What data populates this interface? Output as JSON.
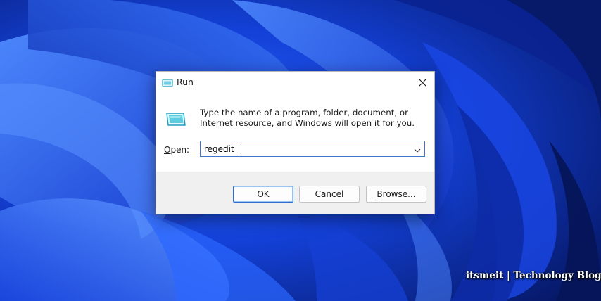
{
  "dialog": {
    "title": "Run",
    "description": "Type the name of a program, folder, document, or Internet resource, and Windows will open it for you.",
    "open_label": "Open:",
    "open_value": "regedit",
    "buttons": {
      "ok": "OK",
      "cancel": "Cancel",
      "browse": "Browse..."
    },
    "icons": {
      "title": "run-icon",
      "large": "run-icon",
      "close": "close-icon",
      "dropdown": "chevron-down-icon"
    }
  },
  "watermark": "itsmeit | Technology Blogs",
  "colors": {
    "wallpaper_dark": "#061a6e",
    "wallpaper_bright": "#2f6dff",
    "accent": "#2f6fd1",
    "footer": "#f0f0f0"
  }
}
